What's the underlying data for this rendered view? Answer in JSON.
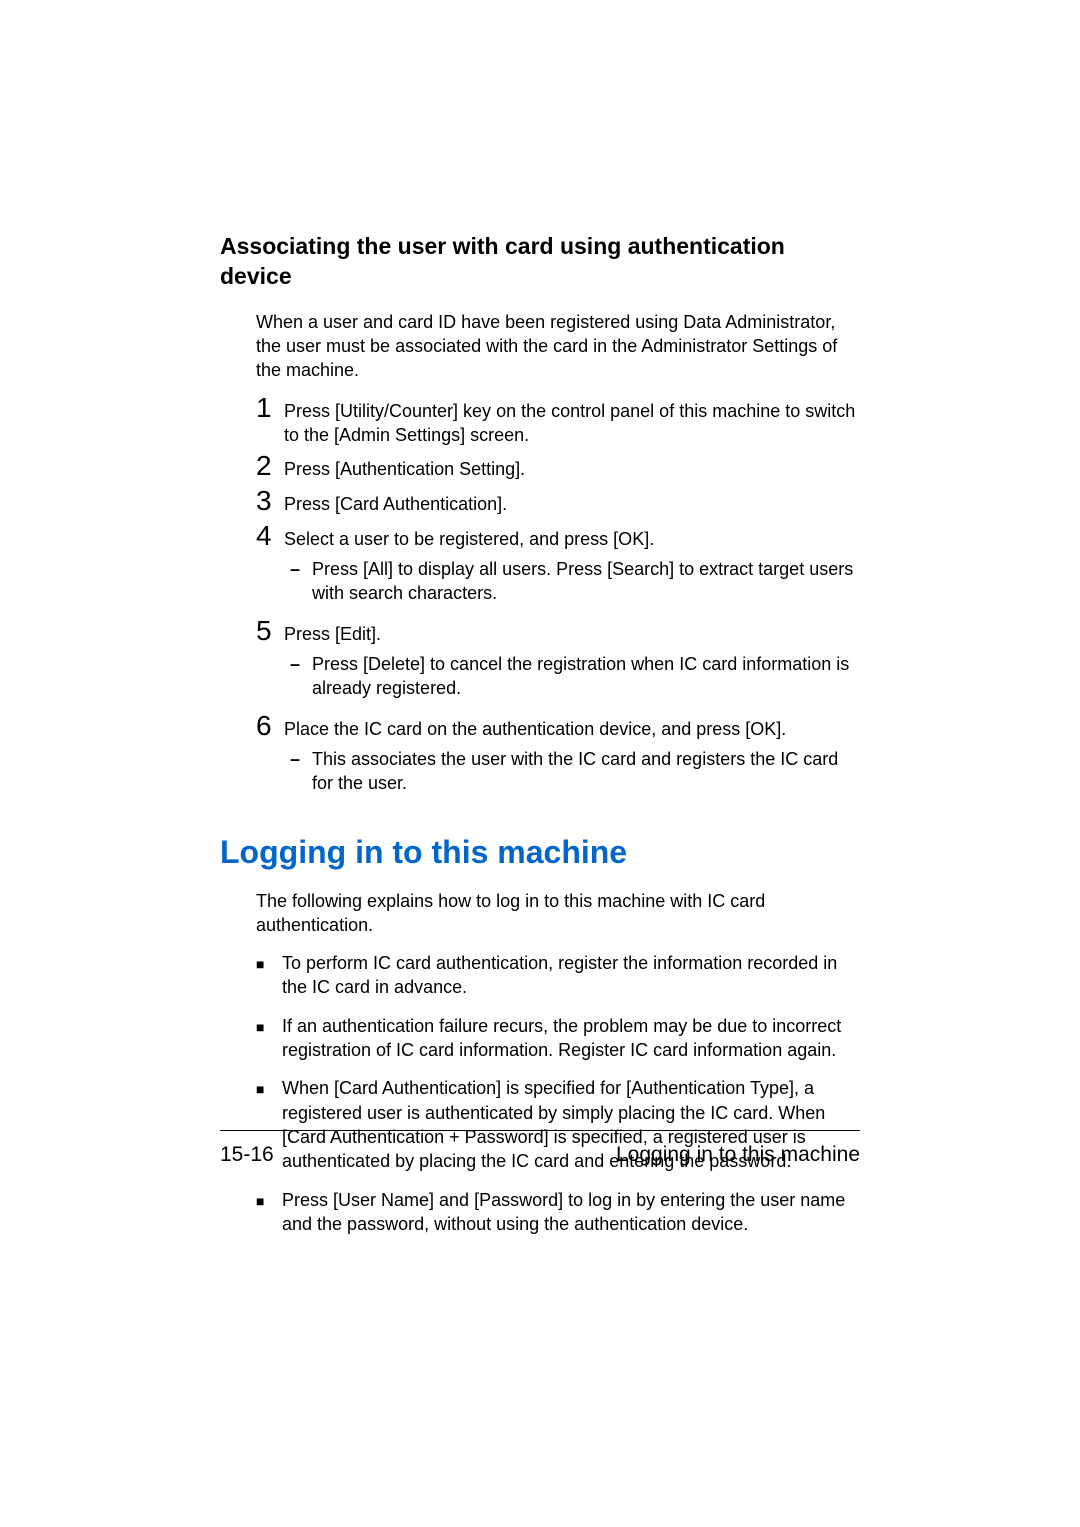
{
  "section1": {
    "heading": "Associating the user with card using authentication device",
    "intro": "When a user and card ID have been registered using Data Administrator, the user must be associated with the card in the Administrator Settings of the machine.",
    "steps": [
      {
        "num": "1",
        "text": "Press [Utility/Counter] key on the control panel of this machine to switch to the [Admin Settings] screen.",
        "subs": []
      },
      {
        "num": "2",
        "text": "Press [Authentication Setting].",
        "subs": []
      },
      {
        "num": "3",
        "text": "Press [Card Authentication].",
        "subs": []
      },
      {
        "num": "4",
        "text": "Select a user to be registered, and press [OK].",
        "subs": [
          "Press [All] to display all users. Press [Search] to extract target users with search characters."
        ]
      },
      {
        "num": "5",
        "text": "Press [Edit].",
        "subs": [
          "Press [Delete] to cancel the registration when IC card information is already registered."
        ]
      },
      {
        "num": "6",
        "text": "Place the IC card on the authentication device, and press [OK].",
        "subs": [
          "This associates the user with the IC card and registers the IC card for the user."
        ]
      }
    ]
  },
  "section2": {
    "heading": "Logging in to this machine",
    "intro": "The following explains how to log in to this machine with IC card authentication.",
    "bullets": [
      "To perform IC card authentication, register the information recorded in the IC card in advance.",
      "If an authentication failure recurs, the problem may be due to incorrect registration of IC card information. Register IC card information again.",
      "When [Card Authentication] is specified for [Authentication Type], a registered user is authenticated by simply placing the IC card. When [Card Authentication + Password] is specified, a registered user is authenticated by placing the IC card and entering the password.",
      "Press [User Name] and [Password] to log in by entering the user name and the password, without using the authentication device."
    ]
  },
  "footer": {
    "page_num": "15-16",
    "title": "Logging in to this machine"
  }
}
